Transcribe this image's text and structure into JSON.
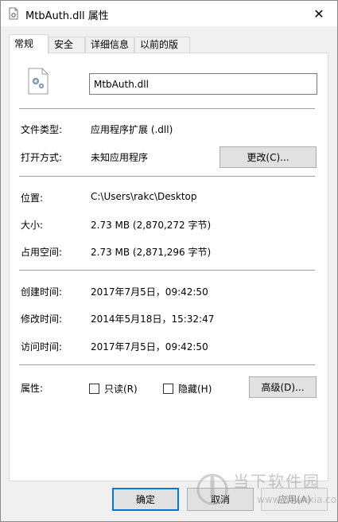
{
  "window": {
    "title": "MtbAuth.dll 属性",
    "close_symbol": "✕"
  },
  "tabs": [
    {
      "label": "常规",
      "active": true
    },
    {
      "label": "安全"
    },
    {
      "label": "详细信息"
    },
    {
      "label": "以前的版本"
    }
  ],
  "general": {
    "file_name": "MtbAuth.dll",
    "file_type_label": "文件类型:",
    "file_type_value": "应用程序扩展 (.dll)",
    "opens_with_label": "打开方式:",
    "opens_with_value": "未知应用程序",
    "change_button": "更改(C)...",
    "location_label": "位置:",
    "location_value": "C:\\Users\\rakc\\Desktop",
    "size_label": "大小:",
    "size_value": "2.73 MB (2,870,272 字节)",
    "size_on_disk_label": "占用空间:",
    "size_on_disk_value": "2.73 MB (2,871,296 字节)",
    "created_label": "创建时间:",
    "created_value": "2017年7月5日，09:42:50",
    "modified_label": "修改时间:",
    "modified_value": "2014年5月18日，15:32:47",
    "accessed_label": "访问时间:",
    "accessed_value": "2017年7月5日，09:42:50",
    "attributes_label": "属性:",
    "readonly_label": "只读(R)",
    "hidden_label": "隐藏(H)",
    "advanced_button": "高级(D)..."
  },
  "footer": {
    "ok": "确定",
    "cancel": "取消",
    "apply": "应用(A)"
  },
  "watermark": {
    "brand": "当下软件园",
    "url": "www.downxia.com"
  },
  "icons": {
    "window": "dll-file-icon",
    "file": "dll-file-gear-icon"
  }
}
